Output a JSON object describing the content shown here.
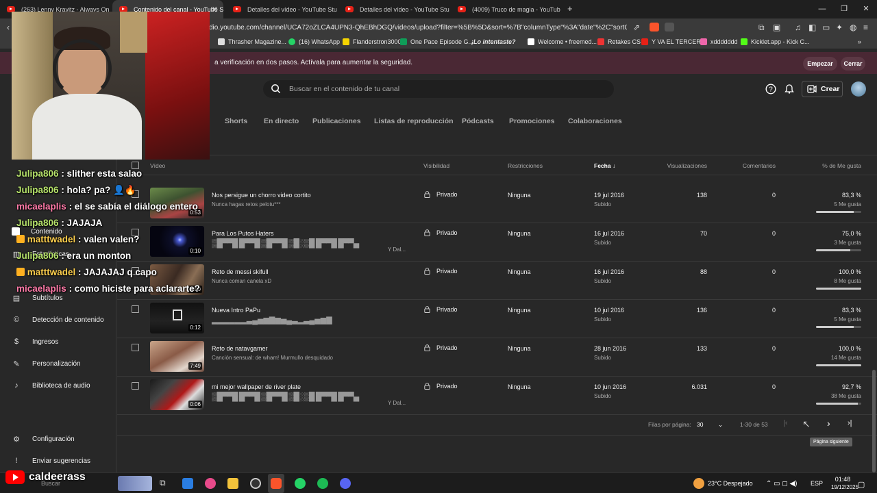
{
  "browser": {
    "tabs": [
      {
        "label": "(263) Lenny Kravitz - Always On The"
      },
      {
        "label": "Contenido del canal - YouTube S"
      },
      {
        "label": "Detalles del vídeo - YouTube Studio"
      },
      {
        "label": "Detalles del vídeo - YouTube Studio"
      },
      {
        "label": "(4009) Truco de magia - YouTube"
      }
    ],
    "url": "dio.youtube.com/channel/UCA72oZLCA4UPN3-QhEBhDGQ/videos/upload?filter=%5B%5D&sort=%7B\"columnType\"%3A\"date\"%2C\"sortOrder\"%3...",
    "bookmarks": [
      "Thrasher Magazine...",
      "(16) WhatsApp",
      "Flanderstron3000",
      "One Pace Episode G...",
      "¡Lo intentaste?",
      "Welcome • freemed...",
      "Retakes CS",
      "Y VA EL TERCERO",
      "xddddddd",
      "Kicklet.app - Kick C..."
    ]
  },
  "security": {
    "text": "a verificación en dos pasos. Actívala para aumentar la seguridad.",
    "start": "Empezar",
    "close": "Cerrar"
  },
  "header": {
    "search_placeholder": "Buscar en el contenido de tu canal",
    "create": "Crear"
  },
  "tabs": [
    "Shorts",
    "En directo",
    "Publicaciones",
    "Listas de reproducción",
    "Pódcasts",
    "Promociones",
    "Colaboraciones"
  ],
  "sidebar": {
    "items": [
      {
        "label": "Contenido",
        "icon": "content-icon"
      },
      {
        "label": "Estadísticas",
        "icon": "analytics-icon"
      },
      {
        "label": "Subtítulos",
        "icon": "subtitles-icon"
      },
      {
        "label": "Detección de contenido",
        "icon": "copyright-icon"
      },
      {
        "label": "Ingresos",
        "icon": "dollar-icon"
      },
      {
        "label": "Personalización",
        "icon": "wand-icon"
      },
      {
        "label": "Biblioteca de audio",
        "icon": "audio-library-icon"
      }
    ],
    "settings": "Configuración",
    "feedback": "Enviar sugerencias"
  },
  "table": {
    "headers": {
      "video": "Vídeo",
      "visibility": "Visibilidad",
      "restrictions": "Restricciones",
      "date": "Fecha",
      "views": "Visualizaciones",
      "comments": "Comentarios",
      "likes": "% de Me gusta"
    },
    "rows": [
      {
        "title": "Nos persigue un chorro video cortito",
        "desc": "Nunca hagas retos pelotu***",
        "duration": "0:53",
        "visibility": "Privado",
        "restrictions": "Ninguna",
        "date": "19 jul 2016",
        "date_sub": "Subido",
        "views": "138",
        "comments": "0",
        "like_pct": "83,3 %",
        "likes": "5 Me gusta",
        "like_frac": 0.833
      },
      {
        "title": "Para Los Putos Haters",
        "desc": "▒█▀▀█ █▀▀█ ▒█▀▀█ ▒█░▒█ █▀▀█ █▀▀▄",
        "desc_tail": "Y Dal...",
        "duration": "0:10",
        "visibility": "Privado",
        "restrictions": "Ninguna",
        "date": "16 jul 2016",
        "date_sub": "Subido",
        "views": "70",
        "comments": "0",
        "like_pct": "75,0 %",
        "likes": "3 Me gusta",
        "like_frac": 0.75
      },
      {
        "title": "Reto de messi skifull",
        "desc": "Nunca coman canela xD",
        "duration": "3:00",
        "visibility": "Privado",
        "restrictions": "Ninguna",
        "date": "16 jul 2016",
        "date_sub": "Subido",
        "views": "88",
        "comments": "0",
        "like_pct": "100,0 %",
        "likes": "8 Me gusta",
        "like_frac": 1.0
      },
      {
        "title": "Nueva Intro PaPu",
        "desc": "▂▂▂▂▂▂▃▄▅▆▇▆▅▄▃▂▃▄▅▆▇",
        "duration": "0:12",
        "visibility": "Privado",
        "restrictions": "Ninguna",
        "date": "10 jul 2016",
        "date_sub": "Subido",
        "views": "136",
        "comments": "0",
        "like_pct": "83,3 %",
        "likes": "5 Me gusta",
        "like_frac": 0.833
      },
      {
        "title": "Reto de natavgamer",
        "desc": "Canción sensual: de wham! Murmullo desquidado",
        "duration": "7:49",
        "visibility": "Privado",
        "restrictions": "Ninguna",
        "date": "28 jun 2016",
        "date_sub": "Subido",
        "views": "133",
        "comments": "0",
        "like_pct": "100,0 %",
        "likes": "14 Me gusta",
        "like_frac": 1.0
      },
      {
        "title": "mi mejor wallpaper de river plate",
        "desc": "▒█▀▀█ █▀▀█ ▒█▀▀█ ▒█░▒█ █▀▀█ █▀▀▄",
        "desc_tail": "Y Dal...",
        "duration": "0:06",
        "visibility": "Privado",
        "restrictions": "Ninguna",
        "date": "10 jun 2016",
        "date_sub": "Subido",
        "views": "6.031",
        "comments": "0",
        "like_pct": "92,7 %",
        "likes": "38 Me gusta",
        "like_frac": 0.927
      }
    ]
  },
  "pagination": {
    "rows_label": "Filas por página:",
    "rows_value": "30",
    "range": "1-30 de 53",
    "tooltip": "Página siguiente"
  },
  "chat": [
    {
      "user": "Julipa806",
      "text": ": slither esta salao",
      "color": "u1"
    },
    {
      "user": "Julipa806",
      "text": ": hola? pa? 👤🔥",
      "color": "u1"
    },
    {
      "user": "micaelaplis",
      "text": ": el se sabía el diálogo entero",
      "color": "u2"
    },
    {
      "user": "Julipa806",
      "text": ": JAJAJA",
      "color": "u1"
    },
    {
      "user": "matttwadel",
      "text": ": valen valen?",
      "color": "u3"
    },
    {
      "user": "Julipa806",
      "text": ": era un monton",
      "color": "u1"
    },
    {
      "user": "matttwadel",
      "text": ": JAJAJAJ q capo",
      "color": "u3"
    },
    {
      "user": "micaelaplis",
      "text": ": como hiciste para aclararte?",
      "color": "u2"
    }
  ],
  "stream_badge": "caldeerass",
  "taskbar": {
    "weather": "23°C Despejado",
    "lang": "ESP",
    "time": "01:48",
    "date": "19/12/2025",
    "search": "Buscar"
  },
  "colors": {
    "accent_red": "#ff0000",
    "panel": "#282828",
    "security_bar": "#4a2834"
  }
}
